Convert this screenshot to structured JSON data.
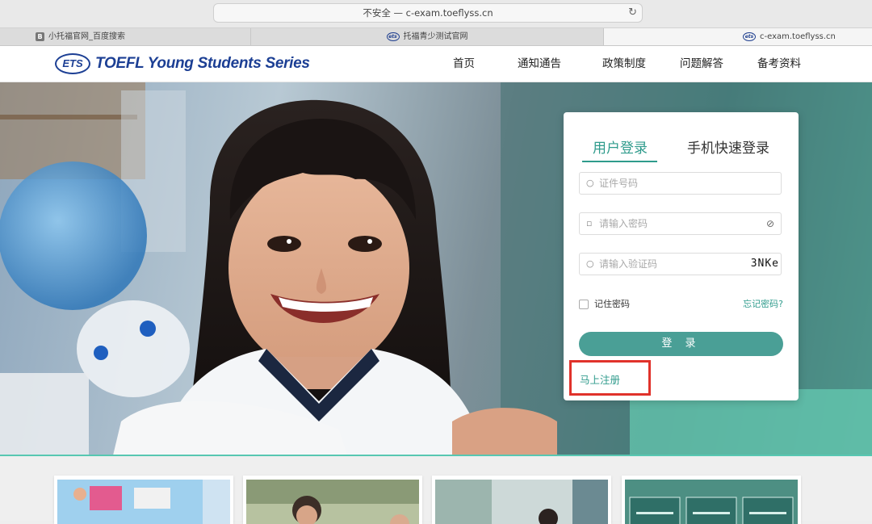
{
  "browser": {
    "address": "不安全 — c-exam.toeflyss.cn",
    "tabs": [
      {
        "label": "小托福官网_百度搜索",
        "favicon": "baidu-icon"
      },
      {
        "label": "托福青少测试官网",
        "favicon": "ets-icon"
      },
      {
        "label": "c-exam.toeflyss.cn",
        "favicon": "ets-icon"
      }
    ]
  },
  "header": {
    "logo_mark": "ETS",
    "logo_text": "TOEFL Young Students Series",
    "nav": [
      "首页",
      "通知通告",
      "政策制度",
      "问题解答",
      "备考资料"
    ]
  },
  "login": {
    "tab_user": "用户登录",
    "tab_phone": "手机快速登录",
    "id_placeholder": "证件号码",
    "password_placeholder": "请输入密码",
    "captcha_placeholder": "请输入验证码",
    "captcha_text": "3NKe",
    "remember_label": "记住密码",
    "forgot_link": "忘记密码?",
    "login_button": "登 录",
    "register_link": "马上注册"
  },
  "colors": {
    "accent": "#2f9b8c",
    "button": "#4a9f96",
    "highlight": "#e0322b",
    "logo": "#1c3f94"
  }
}
